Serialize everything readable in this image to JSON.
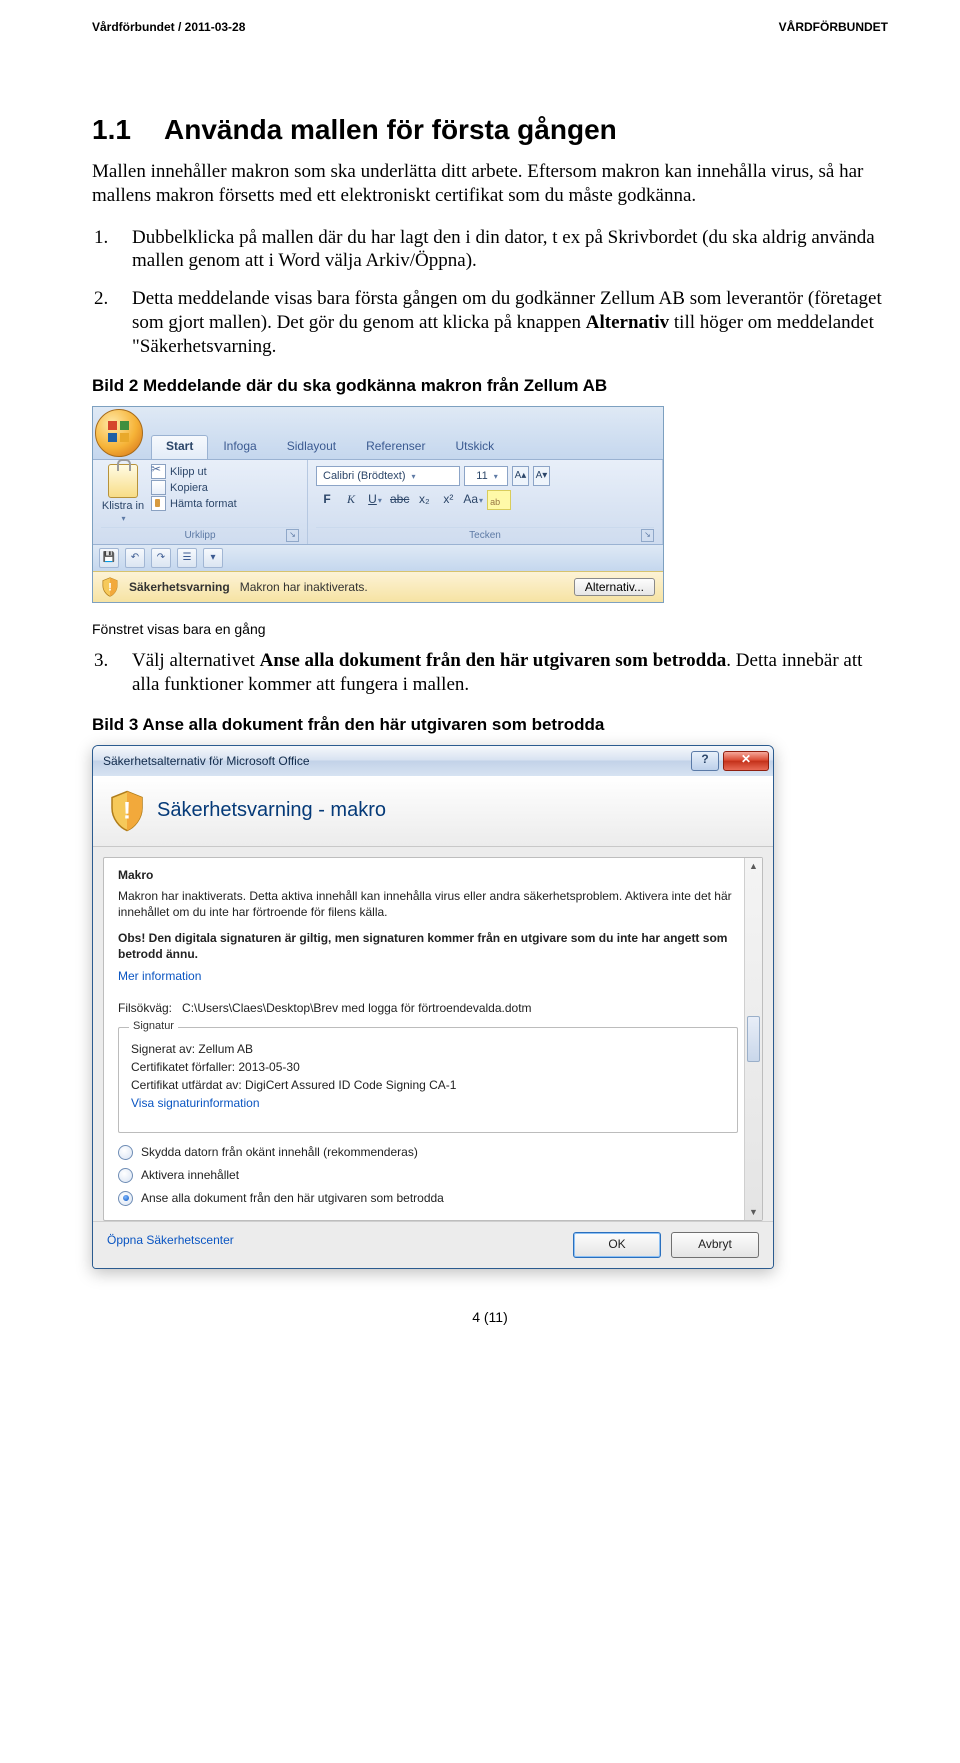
{
  "header": {
    "left": "Vårdförbundet / 2011-03-28",
    "right": "VÅRDFÖRBUNDET"
  },
  "section": {
    "number": "1.1",
    "title": "Använda mallen för första gången"
  },
  "intro": "Mallen innehåller makron som ska underlätta ditt arbete. Eftersom makron kan innehålla virus, så har mallens makron försetts med ett elektroniskt certifikat som du måste godkänna.",
  "steps12": [
    {
      "no": "1.",
      "text": "Dubbelklicka på mallen där du har lagt den i din dator, t ex på Skrivbordet (du ska aldrig använda mallen genom att i Word välja Arkiv/Öppna)."
    },
    {
      "no": "2.",
      "text_before": "Detta meddelande visas bara första gången om du godkänner Zellum AB som leverantör (företaget som gjort mallen). Det gör du genom att klicka på knappen ",
      "bold": "Alternativ",
      "text_after": " till höger om meddelandet \"Säkerhetsvarning."
    }
  ],
  "caption2": "Bild 2 Meddelande där du ska godkänna makron från Zellum AB",
  "ribbon": {
    "tabs": [
      "Start",
      "Infoga",
      "Sidlayout",
      "Referenser",
      "Utskick"
    ],
    "clipboard": {
      "big": "Klistra in",
      "cut": "Klipp ut",
      "copy": "Kopiera",
      "format": "Hämta format",
      "title": "Urklipp"
    },
    "font": {
      "name": "Calibri (Brödtext)",
      "size": "11",
      "title": "Tecken",
      "btns": {
        "bold": "F",
        "italic": "K",
        "underline": "U",
        "strike": "abc",
        "sub": "x₂",
        "sup": "x²",
        "case": "Aa"
      }
    },
    "msgbar": {
      "label": "Säkerhetsvarning",
      "text": "Makron har inaktiverats.",
      "button": "Alternativ..."
    }
  },
  "figure2_note": "Fönstret visas bara en gång",
  "step3": {
    "no": "3.",
    "before": "Välj alternativet ",
    "bold": "Anse alla dokument från den här utgivaren som betrodda",
    "after": ". Detta innebär att alla funktioner kommer att fungera i mallen."
  },
  "caption3": "Bild 3 Anse alla dokument från den här utgivaren som betrodda",
  "dialog": {
    "title": "Säkerhetsalternativ för Microsoft Office",
    "banner": "Säkerhetsvarning - makro",
    "group": "Makro",
    "para": "Makron har inaktiverats. Detta aktiva innehåll kan innehålla virus eller andra säkerhetsproblem. Aktivera inte det här innehållet om du inte har förtroende för filens källa.",
    "note": "Obs! Den digitala signaturen är giltig, men signaturen kommer från en utgivare som du inte har angett som betrodd ännu.",
    "more": "Mer information",
    "pathlabel": "Filsökväg:",
    "path": "C:\\Users\\Claes\\Desktop\\Brev med logga för förtroendevalda.dotm",
    "sig": {
      "legend": "Signatur",
      "signed": "Signerat av: Zellum AB",
      "expires": "Certifikatet förfaller: 2013-05-30",
      "issuer": "Certifikat utfärdat av: DigiCert Assured ID Code Signing CA-1",
      "link": "Visa signaturinformation"
    },
    "radios": [
      {
        "label": "Skydda datorn från okänt innehåll (rekommenderas)",
        "selected": false
      },
      {
        "label": "Aktivera innehållet",
        "selected": false
      },
      {
        "label": "Anse alla dokument från den här utgivaren som betrodda",
        "selected": true
      }
    ],
    "footer": {
      "trustcenter": "Öppna Säkerhetscenter",
      "ok": "OK",
      "cancel": "Avbryt"
    }
  },
  "footer": "4 (11)"
}
